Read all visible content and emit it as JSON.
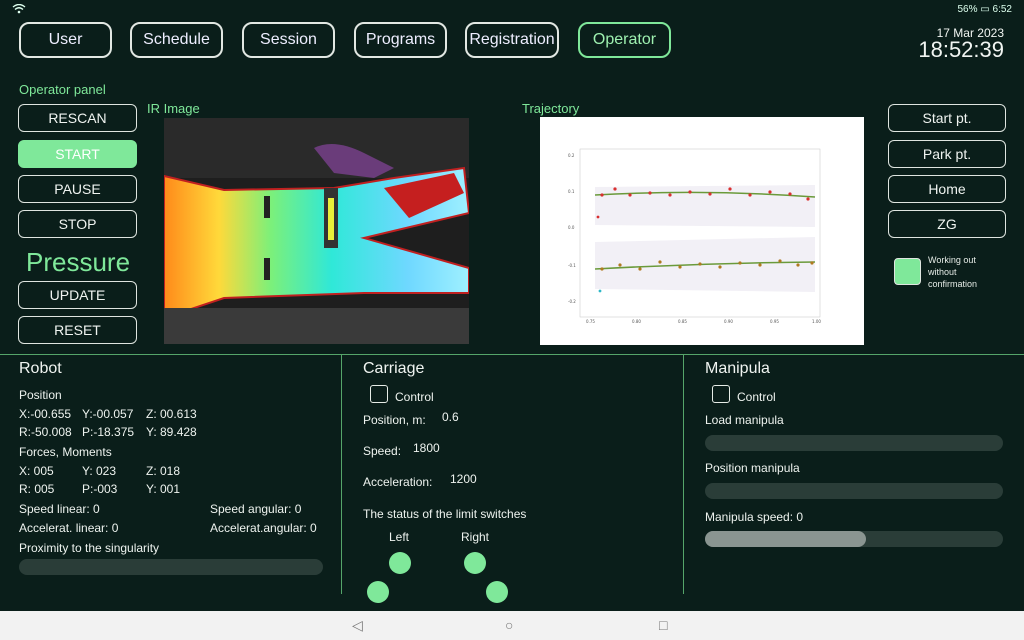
{
  "statusbar": {
    "left_icons": "wifi",
    "battery": "56%",
    "time": "6:52"
  },
  "topnav": [
    "User",
    "Schedule",
    "Session",
    "Programs",
    "Registration",
    "Operator"
  ],
  "active_tab": "Operator",
  "clock": {
    "date": "17 Mar 2023",
    "time": "18:52:39"
  },
  "operator_panel": {
    "label": "Operator panel",
    "buttons": [
      "RESCAN",
      "START",
      "PAUSE",
      "STOP"
    ],
    "pressure_label": "Pressure",
    "pressure_buttons": [
      "UPDATE",
      "RESET"
    ]
  },
  "ir_label": "IR Image",
  "trajectory_label": "Trajectory",
  "right_buttons": [
    "Start pt.",
    "Park pt.",
    "Home",
    "ZG"
  ],
  "working_out": "Working out without confirmation",
  "robot": {
    "title": "Robot",
    "position_label": "Position",
    "x": "X:-00.655",
    "y": "Y:-00.057",
    "z": "Z: 00.613",
    "r": "R:-50.008",
    "p": "P:-18.375",
    "yaw": "Y: 89.428",
    "forces_label": "Forces, Moments",
    "fx": "X: 005",
    "fy": "Y: 023",
    "fz": "Z: 018",
    "fr": "R: 005",
    "fp": "P:-003",
    "fyaw": "Y: 001",
    "speed_linear": "Speed linear: 0",
    "speed_angular": "Speed angular: 0",
    "accel_linear": "Accelerat. linear: 0",
    "accel_angular": "Accelerat.angular: 0",
    "proximity_label": "Proximity to the singularity"
  },
  "carriage": {
    "title": "Carriage",
    "control_label": "Control",
    "position_label": "Position, m:",
    "position_value": "0.6",
    "speed_label": "Speed:",
    "speed_value": "1800",
    "accel_label": "Acceleration:",
    "accel_value": "1200",
    "limit_label": "The status of the limit switches",
    "left_label": "Left",
    "right_label": "Right"
  },
  "manipula": {
    "title": "Manipula",
    "control_label": "Control",
    "load_label": "Load manipula",
    "position_label": "Position manipula",
    "speed_label": "Manipula speed: 0",
    "speed_fill_fraction": 0.54
  },
  "colors": {
    "accent": "#7fe89a",
    "background": "#0a1e1a"
  }
}
